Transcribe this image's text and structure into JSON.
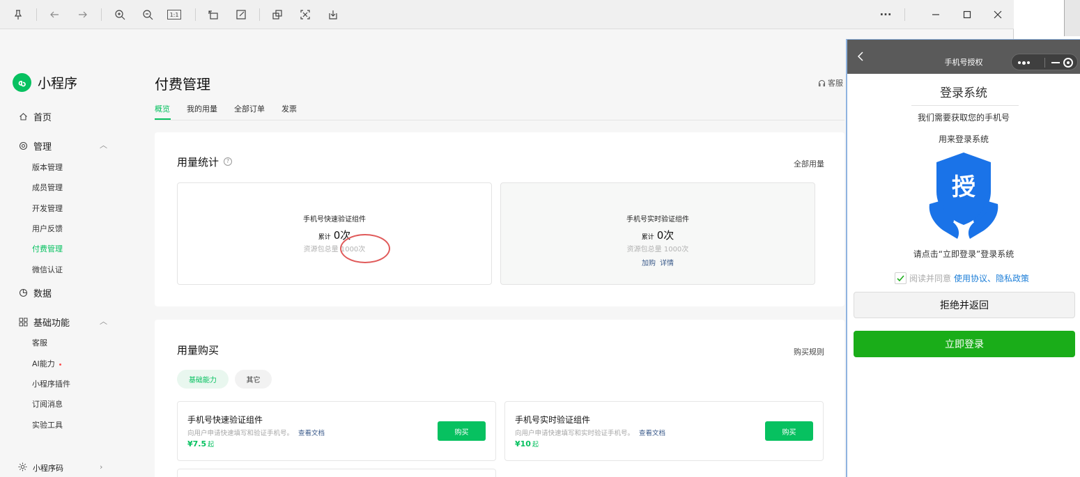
{
  "viewer": {
    "toolbar": {
      "icons": [
        "pin-icon",
        "back-arrow-icon",
        "forward-arrow-icon",
        "zoom-in-icon",
        "zoom-out-icon",
        "actual-size-icon",
        "rotate-icon",
        "edit-icon",
        "extract-text-icon",
        "scan-icon",
        "download-icon",
        "more-icon",
        "minimize-icon",
        "maximize-icon",
        "close-icon"
      ],
      "actual_size_label": "1:1",
      "more_label": "···"
    }
  },
  "sidebar": {
    "app_name": "小程序",
    "home": "首页",
    "manage": {
      "label": "管理",
      "items": [
        "版本管理",
        "成员管理",
        "开发管理",
        "用户反馈",
        "付费管理",
        "微信认证"
      ]
    },
    "data": "数据",
    "basic": {
      "label": "基础功能",
      "items": [
        "客服",
        "AI能力",
        "小程序插件",
        "订阅消息",
        "实验工具"
      ]
    },
    "qrcode": "小程序码"
  },
  "main": {
    "title": "付费管理",
    "service_label": "客服",
    "tabs": [
      "概览",
      "我的用量",
      "全部订单",
      "发票"
    ],
    "usage_stats": {
      "title": "用量统计",
      "help_icon": "?",
      "link": "全部用量",
      "boxes": [
        {
          "name": "手机号快速验证组件",
          "count_prefix": "累计",
          "count": "0次",
          "pack": "资源包总量 1000次"
        },
        {
          "name": "手机号实时验证组件",
          "count_prefix": "累计",
          "count": "0次",
          "pack": "资源包总量 1000次",
          "actions": [
            "加购",
            "详情"
          ]
        }
      ]
    },
    "purchase": {
      "title": "用量购买",
      "link": "购买规则",
      "pills": [
        "基础能力",
        "其它"
      ],
      "items": [
        {
          "name": "手机号快速验证组件",
          "desc": "向用户申请快速填写和验证手机号。",
          "doc": "查看文档",
          "price": "¥7.5",
          "price_unit": "起",
          "button": "购买"
        },
        {
          "name": "手机号实时验证组件",
          "desc": "向用户申请快速填写和实时验证手机号。",
          "doc": "查看文档",
          "price": "¥10",
          "price_unit": "起",
          "button": "购买"
        }
      ]
    }
  },
  "simulator": {
    "nav_title": "手机号授权",
    "login_title": "登录系统",
    "need_text": "我们需要获取您的手机号",
    "use_text": "用来登录系统",
    "auth_char": "授",
    "tap_text": "请点击“立即登录”登录系统",
    "agree_prefix": "阅读并同意",
    "agree_links": "使用协议、隐私政策",
    "agree_checked": true,
    "reject_button": "拒绝并返回",
    "login_button": "立即登录",
    "colors": {
      "primary_green": "#1aad19",
      "link_blue": "#1e7fd8",
      "shield_blue": "#1a73e8"
    }
  }
}
